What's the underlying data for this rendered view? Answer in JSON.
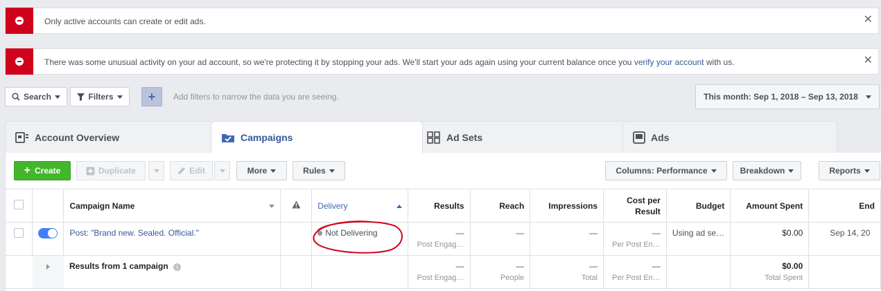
{
  "alerts": [
    {
      "text": "Only active accounts can create or edit ads."
    },
    {
      "text_before": "There was some unusual activity on your ad account, so we're protecting it by stopping your ads. We'll start your ads again using your current balance once you ",
      "link": "verify your account",
      "text_after": " with us."
    }
  ],
  "filterbar": {
    "search_label": "Search",
    "filters_label": "Filters",
    "add_filter_hint": "Add filters to narrow the data you are seeing.",
    "date_range": "This month: Sep 1, 2018 – Sep 13, 2018"
  },
  "tabs": [
    "Account Overview",
    "Campaigns",
    "Ad Sets",
    "Ads"
  ],
  "toolbar": {
    "create": "Create",
    "duplicate": "Duplicate",
    "edit": "Edit",
    "more": "More",
    "rules": "Rules",
    "columns": "Columns: Performance",
    "breakdown": "Breakdown",
    "reports": "Reports"
  },
  "table": {
    "headers": {
      "name": "Campaign Name",
      "delivery": "Delivery",
      "results": "Results",
      "reach": "Reach",
      "impressions": "Impressions",
      "cost_line1": "Cost per",
      "cost_line2": "Result",
      "budget": "Budget",
      "amount_spent": "Amount Spent",
      "ends": "End"
    },
    "row": {
      "name": "Post: \"Brand new. Sealed. Official.\"",
      "delivery": "Not Delivering",
      "results": "—",
      "results_sub": "Post Engag…",
      "reach": "—",
      "impressions": "—",
      "cost": "—",
      "cost_sub": "Per Post En…",
      "budget": "Using ad se…",
      "amount_spent": "$0.00",
      "ends": "Sep 14, 20"
    },
    "summary": {
      "label": "Results from 1 campaign",
      "results": "—",
      "results_sub": "Post Engag…",
      "reach": "—",
      "reach_sub": "People",
      "impressions": "—",
      "impressions_sub": "Total",
      "cost": "—",
      "cost_sub": "Per Post En…",
      "amount_spent": "$0.00",
      "amount_sub": "Total Spent"
    }
  },
  "colors": {
    "accent": "#4267b2",
    "error": "#d0021b",
    "create": "#42b72a",
    "annotation": "#d0021b"
  }
}
